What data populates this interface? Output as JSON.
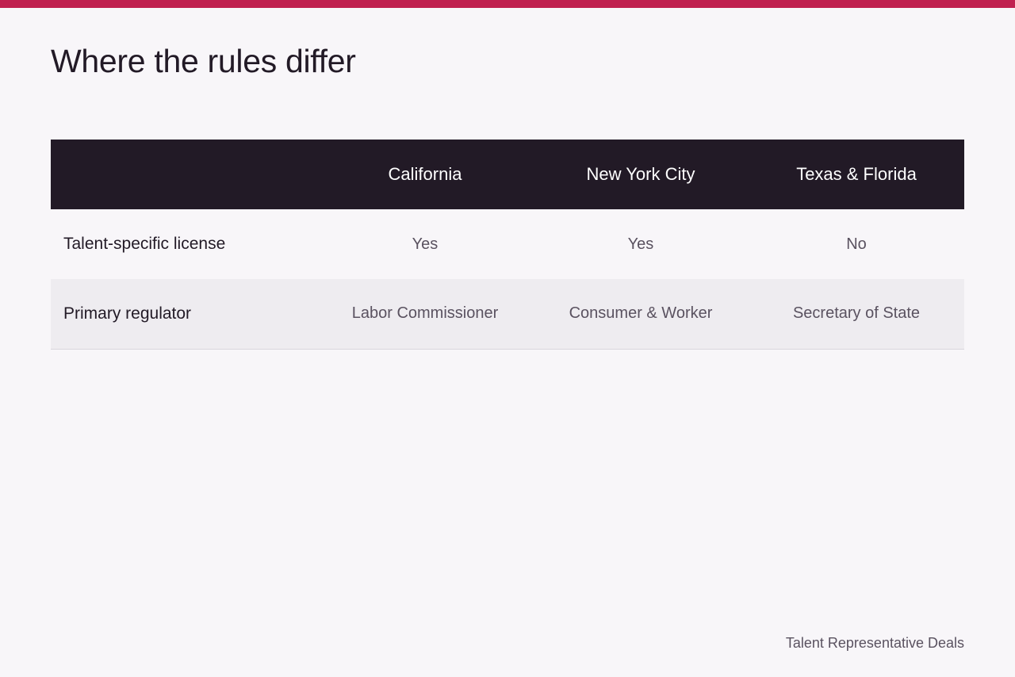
{
  "title": "Where the rules differ",
  "table": {
    "columns": [
      "",
      "California",
      "New York City",
      "Texas & Florida"
    ],
    "rows": [
      {
        "label": "Talent-specific license",
        "cells": [
          "Yes",
          "Yes",
          "No"
        ]
      },
      {
        "label": "Primary regulator",
        "cells": [
          "Labor Commissioner",
          "Consumer & Worker",
          "Secretary of State"
        ]
      }
    ]
  },
  "footer": "Talent Representative Deals",
  "colors": {
    "accent": "#c0204f",
    "header_bg": "#221a26",
    "page_bg": "#f8f6f9",
    "alt_row_bg": "#eeecf0"
  }
}
